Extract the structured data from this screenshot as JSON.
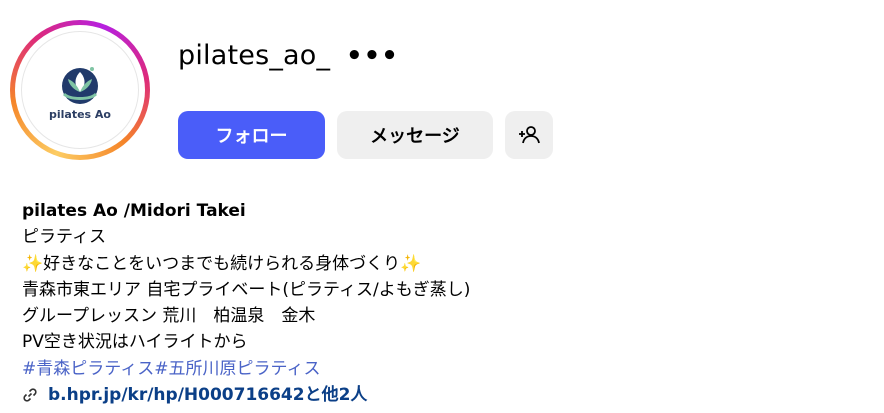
{
  "profile": {
    "username": "pilates_ao_",
    "more_label": "•••",
    "avatar_logo_text": "pilates Ao"
  },
  "actions": {
    "follow_label": "フォロー",
    "message_label": "メッセージ",
    "add_person_icon": "add-person-icon"
  },
  "bio": {
    "display_name": "pilates Ao /Midori Takei",
    "lines": [
      "ピラティス",
      "好きなことをいつまでも続けられる身体づくり",
      "青森市東エリア 自宅プライベート(ピラティス/よもぎ蒸し)",
      "グループレッスン 荒川　柏温泉　金木",
      "PV空き状況はハイライトから"
    ],
    "sparkle_icon": "sparkle-icon",
    "hashtags": "#青森ピラティス#五所川原ピラティス",
    "link_text": "b.hpr.jp/kr/hp/H000716642と他2人",
    "link_icon": "link-icon"
  },
  "colors": {
    "follow_button": "#4a5df9",
    "secondary_button": "#efefef",
    "hashtag": "#4a63c7",
    "link": "#0b3f87"
  }
}
